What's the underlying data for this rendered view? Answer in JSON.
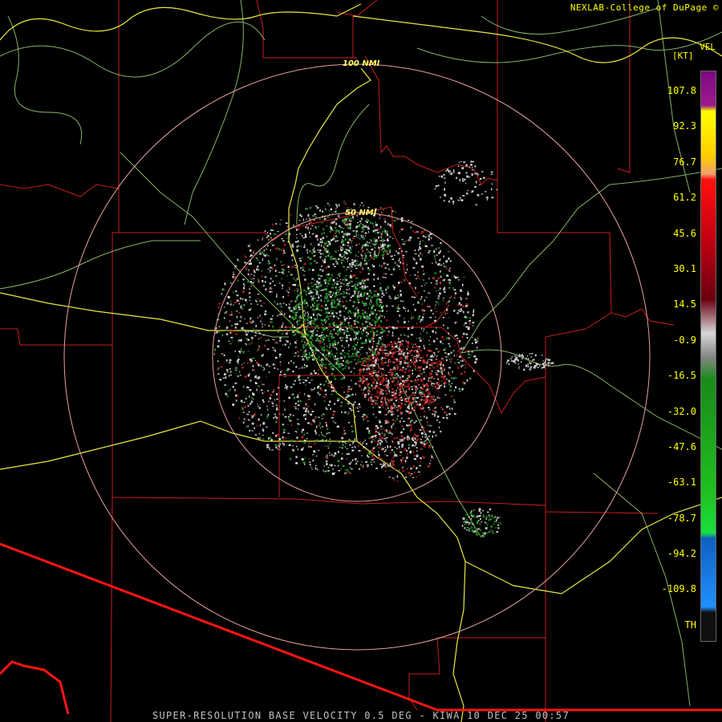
{
  "header": {
    "credit": "NEXLAB-College of DuPage ©"
  },
  "legend": {
    "product": "VEL",
    "units": "[KT]",
    "ticks": [
      "107.8",
      "92.3",
      "76.7",
      "61.2",
      "45.6",
      "30.1",
      "14.5",
      "-0.9",
      "-16.5",
      "-32.0",
      "-47.6",
      "-63.1",
      "-78.7",
      "-94.2",
      "-109.8",
      "TH"
    ]
  },
  "rings": {
    "inner_label": "50 NMI",
    "outer_label": "100 NMI"
  },
  "footer": {
    "caption": "SUPER-RESOLUTION BASE VELOCITY 0.5 DEG - KIWA 10 DEC 25 00:57"
  },
  "colors": {
    "background": "#000000",
    "county_lines": "#c81e1e",
    "highways": "#e8e840",
    "rivers": "#9ed27a",
    "range_rings": "#e8a0a0",
    "border": "#ff1414",
    "inbound": "#1e8c1e",
    "outbound": "#b41e1e",
    "near_zero": "#c8c8c8"
  }
}
